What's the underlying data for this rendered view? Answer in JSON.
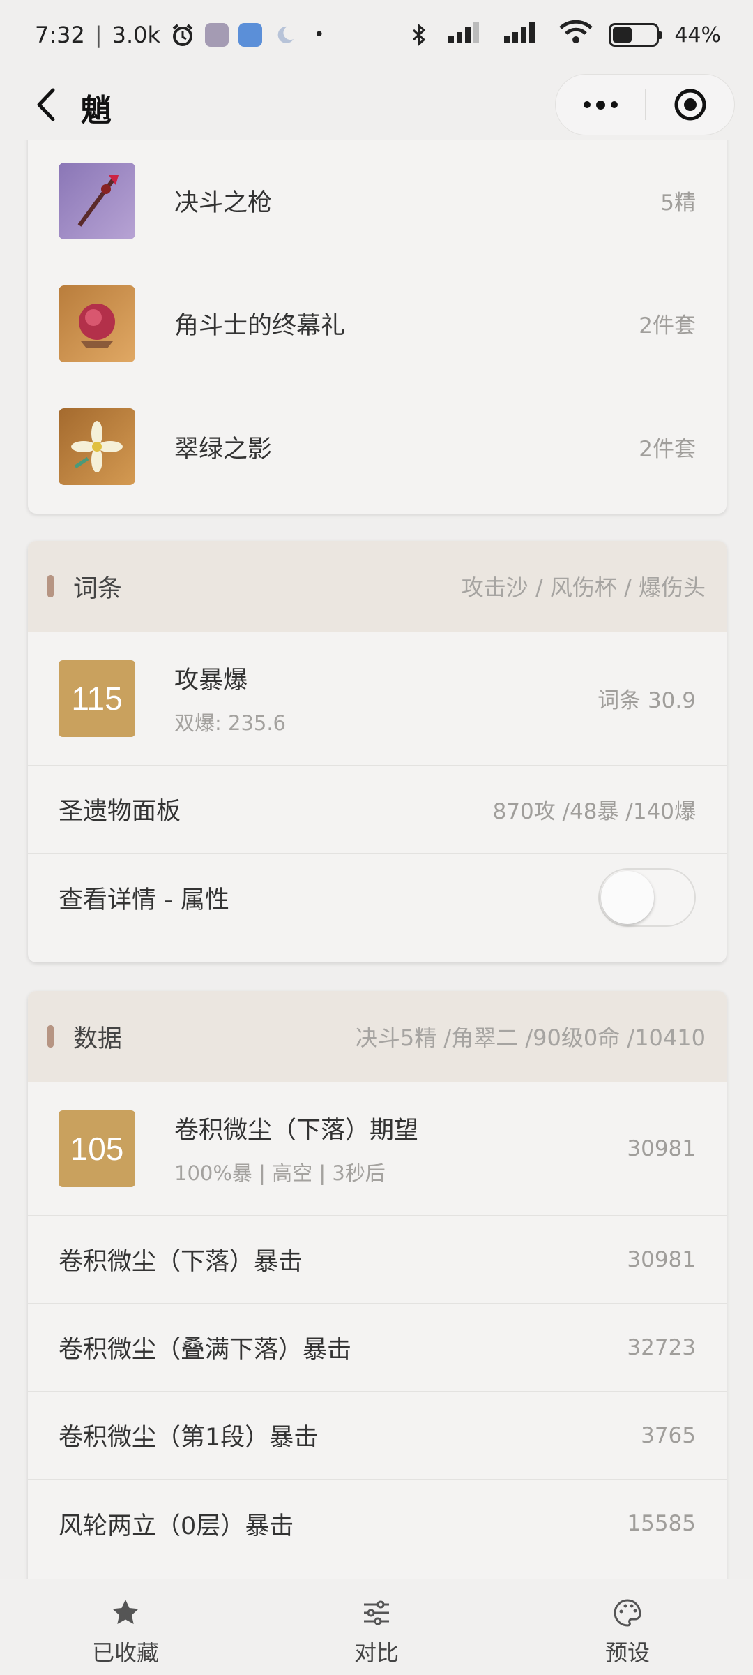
{
  "status_bar": {
    "time": "7:32",
    "speed": "3.0k",
    "battery": "44%",
    "battery_level": 0.44
  },
  "nav": {
    "title": "魈"
  },
  "equipment": [
    {
      "name": "决斗之枪",
      "tag": "5精",
      "icon": "polearm-icon"
    },
    {
      "name": "角斗士的终幕礼",
      "tag": "2件套",
      "icon": "gladiator-artifact-icon"
    },
    {
      "name": "翠绿之影",
      "tag": "2件套",
      "icon": "viridescent-artifact-icon"
    }
  ],
  "substats": {
    "title": "词条",
    "meta": "攻击沙 / 风伤杯 / 爆伤头",
    "score": "115",
    "score_title": "攻暴爆",
    "score_sub": "双爆: 235.6",
    "score_value": "词条 30.9",
    "panel_label": "圣遗物面板",
    "panel_value": "870攻 /48暴 /140爆",
    "detail_label": "查看详情 - 属性",
    "detail_toggle_on": false
  },
  "data_section": {
    "title": "数据",
    "meta": "决斗5精 /角翠二 /90级0命 /10410",
    "score": "105",
    "score_title": "卷积微尘（下落）期望",
    "score_sub": "100%暴 | 高空 | 3秒后",
    "score_value": "30981",
    "rows": [
      {
        "label": "卷积微尘（下落）暴击",
        "value": "30981"
      },
      {
        "label": "卷积微尘（叠满下落）暴击",
        "value": "32723"
      },
      {
        "label": "卷积微尘（第1段）暴击",
        "value": "3765"
      },
      {
        "label": "风轮两立（0层）暴击",
        "value": "15585"
      }
    ]
  },
  "tab_bar": {
    "tabs": [
      {
        "label": "已收藏",
        "icon": "star-icon"
      },
      {
        "label": "对比",
        "icon": "sliders-icon"
      },
      {
        "label": "预设",
        "icon": "palette-icon"
      }
    ]
  },
  "colors": {
    "accent_gold": "#c9a15e",
    "section_bar": "#b69583",
    "section_head_bg": "#ebe6e0"
  }
}
